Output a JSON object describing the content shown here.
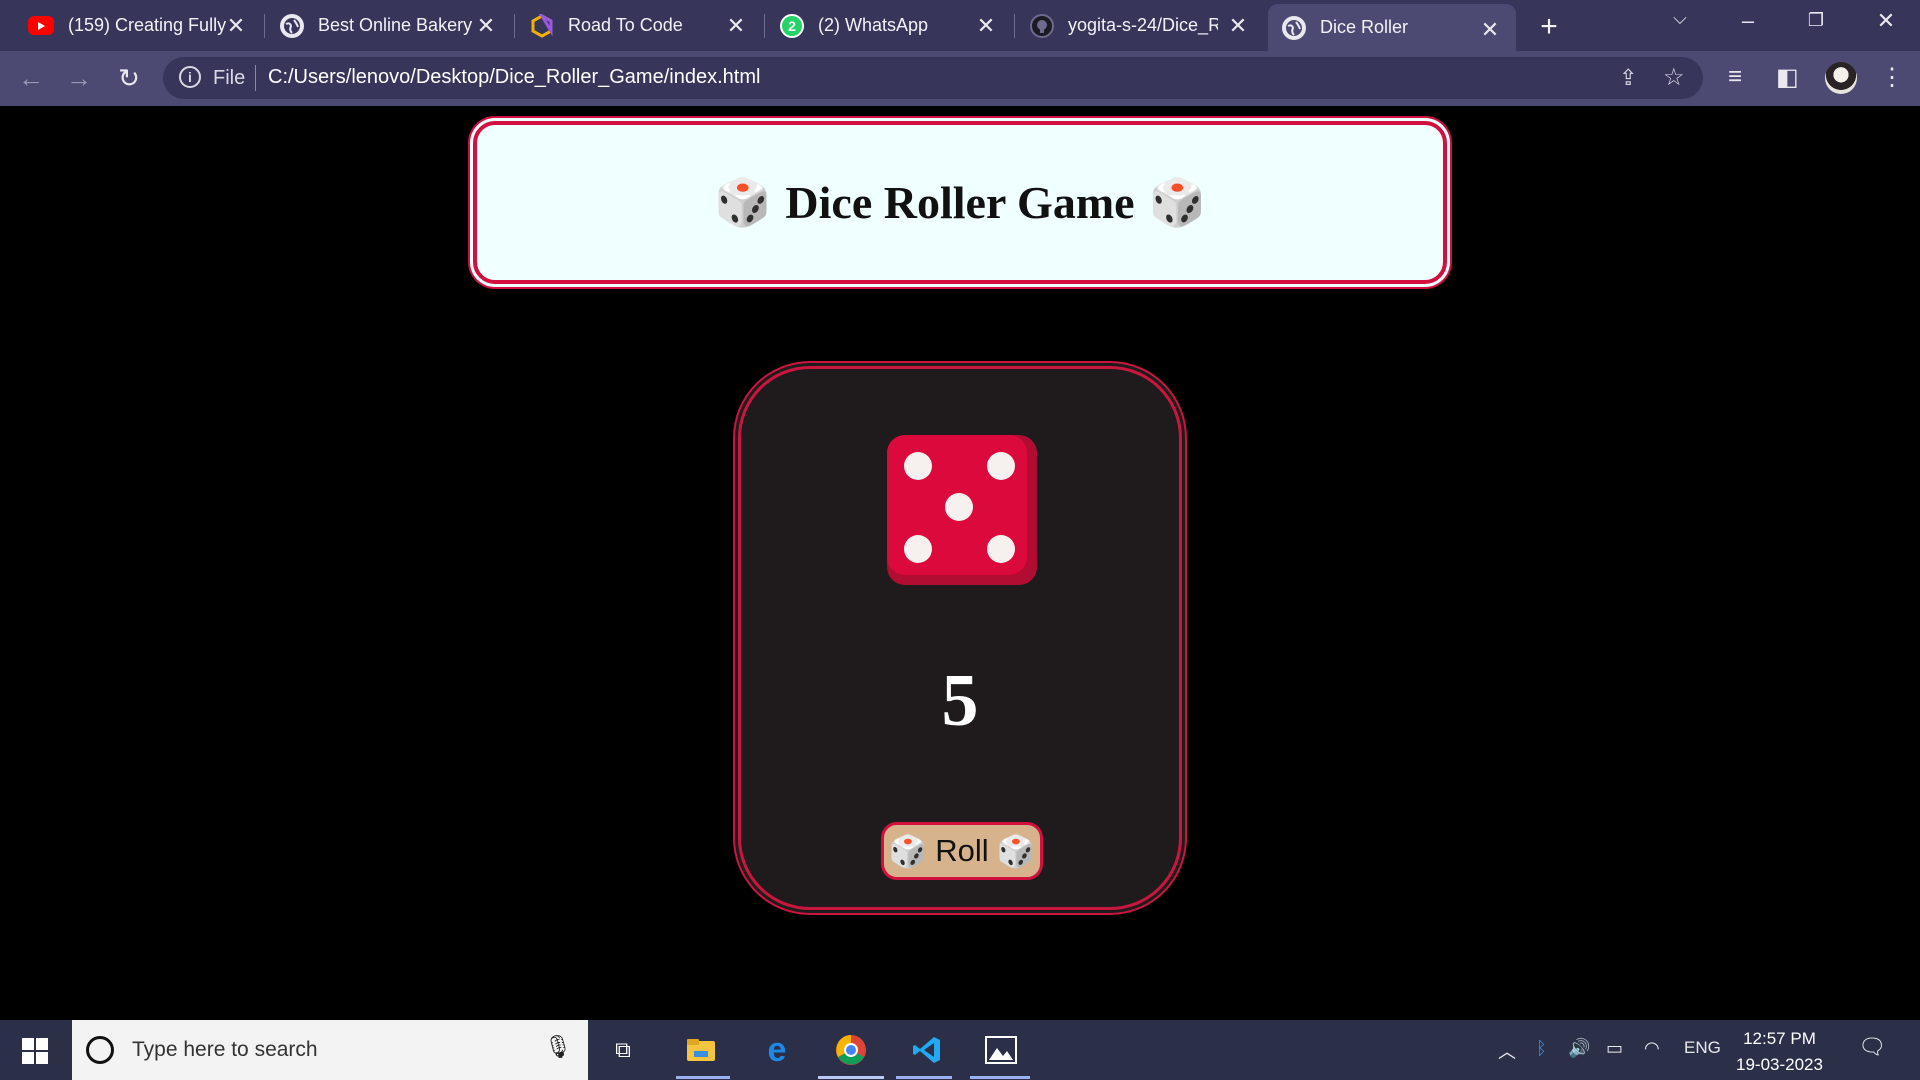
{
  "browser": {
    "tabs": [
      {
        "title": "(159) Creating Fully",
        "icon": "youtube-icon"
      },
      {
        "title": "Best Online Bakery",
        "icon": "globe-icon"
      },
      {
        "title": "Road To Code",
        "icon": "hexagon-logo-icon"
      },
      {
        "title": "(2) WhatsApp",
        "icon": "whatsapp-icon",
        "badge": "2"
      },
      {
        "title": "yogita-s-24/Dice_Ro",
        "icon": "github-icon"
      },
      {
        "title": "Dice Roller",
        "icon": "globe-icon",
        "active": true
      }
    ],
    "address": {
      "scheme_label": "File",
      "url": "C:/Users/lenovo/Desktop/Dice_Roller_Game/index.html"
    }
  },
  "page": {
    "header": {
      "title": "Dice Roller Game",
      "title_emoji": "🎲"
    },
    "game": {
      "die_value": 5,
      "die_color": "#dc0a3c",
      "result": "5",
      "roll_button_label": "Roll",
      "roll_button_emoji": "🎲"
    },
    "colors": {
      "background": "#000000",
      "accent_border": "#d1103f",
      "header_bg": "#f0ffff",
      "card_bg": "#1f1b1d",
      "button_bg": "#d7b38d"
    }
  },
  "taskbar": {
    "search_placeholder": "Type here to search",
    "pinned": [
      "task-view-icon",
      "file-explorer-icon",
      "edge-icon",
      "chrome-icon",
      "vscode-icon",
      "photos-icon"
    ],
    "tray": {
      "language": "ENG",
      "time": "12:57 PM",
      "date": "19-03-2023"
    }
  }
}
